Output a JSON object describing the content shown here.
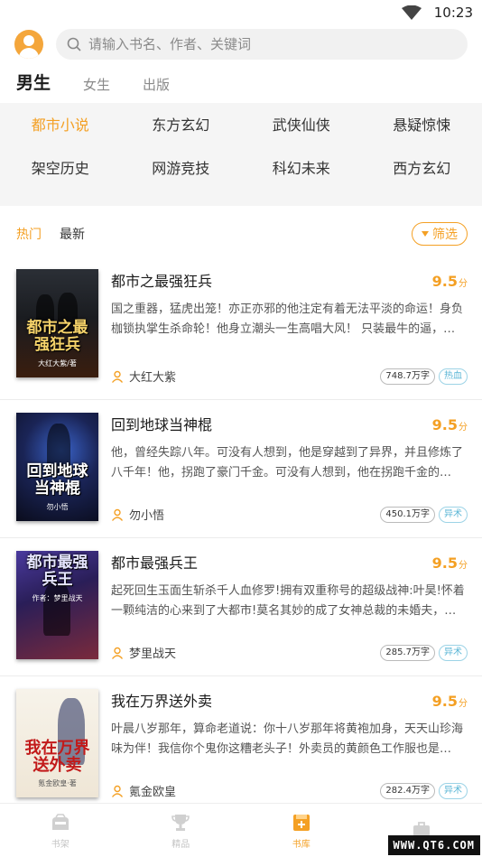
{
  "status_bar": {
    "time": "10:23"
  },
  "search": {
    "placeholder": "请输入书名、作者、关键词"
  },
  "gender_tabs": [
    {
      "label": "男生",
      "active": true
    },
    {
      "label": "女生",
      "active": false
    },
    {
      "label": "出版",
      "active": false
    }
  ],
  "categories": [
    {
      "label": "都市小说",
      "active": true
    },
    {
      "label": "东方玄幻"
    },
    {
      "label": "武侠仙侠"
    },
    {
      "label": "悬疑惊悚"
    },
    {
      "label": "架空历史"
    },
    {
      "label": "网游竞技"
    },
    {
      "label": "科幻未来"
    },
    {
      "label": "西方玄幻"
    }
  ],
  "sort_tabs": [
    {
      "label": "热门",
      "active": true
    },
    {
      "label": "最新",
      "active": false
    }
  ],
  "filter_label": "筛选",
  "books": [
    {
      "title": "都市之最强狂兵",
      "score": "9.5",
      "score_unit": "分",
      "desc": "国之重器，猛虎出笼！亦正亦邪的他注定有着无法平淡的命运！身负枷锁执掌生杀命轮！他身立潮头一生高唱大风！ 只装最牛的逼，…",
      "author": "大红大紫",
      "words": "748.7万字",
      "genre": "热血",
      "cover_title": "都市之最强狂兵",
      "cover_author": "大红大紫/著"
    },
    {
      "title": "回到地球当神棍",
      "score": "9.5",
      "score_unit": "分",
      "desc": "他，曾经失踪八年。可没有人想到，他是穿越到了异界，并且修炼了八千年！他，拐跑了豪门千金。可没有人想到，他在拐跑千金的…",
      "author": "勿小悟",
      "words": "450.1万字",
      "genre": "异术",
      "cover_title": "回到地球当神棍",
      "cover_author": "勿小悟"
    },
    {
      "title": "都市最强兵王",
      "score": "9.5",
      "score_unit": "分",
      "desc": "起死回生玉面生斩杀千人血修罗!拥有双重称号的超级战神:叶昊!怀着一颗纯洁的心来到了大都市!莫名其妙的成了女神总裁的未婚夫，清…",
      "author": "梦里战天",
      "words": "285.7万字",
      "genre": "异术",
      "cover_title": "都市最强兵王",
      "cover_author": "作者：梦里战天"
    },
    {
      "title": "我在万界送外卖",
      "score": "9.5",
      "score_unit": "分",
      "desc": "叶晨八岁那年，算命老道说：你十八岁那年将黄袍加身，天天山珍海味为伴！我信你个鬼你这糟老头子！外卖员的黄颜色工作服也是…",
      "author": "氪金欧皇",
      "words": "282.4万字",
      "genre": "异术",
      "cover_title": "我在万界送外卖",
      "cover_author": "氪金欧皇·著"
    }
  ],
  "bottom_nav": [
    {
      "label": "书架",
      "active": false
    },
    {
      "label": "精品",
      "active": false
    },
    {
      "label": "书库",
      "active": true
    },
    {
      "label": "",
      "active": false
    }
  ],
  "watermark": "WWW.QT6.COM",
  "colors": {
    "accent": "#f4a024",
    "genre_tag": "#5bb6d6",
    "category_bg": "#f5f5f5"
  }
}
